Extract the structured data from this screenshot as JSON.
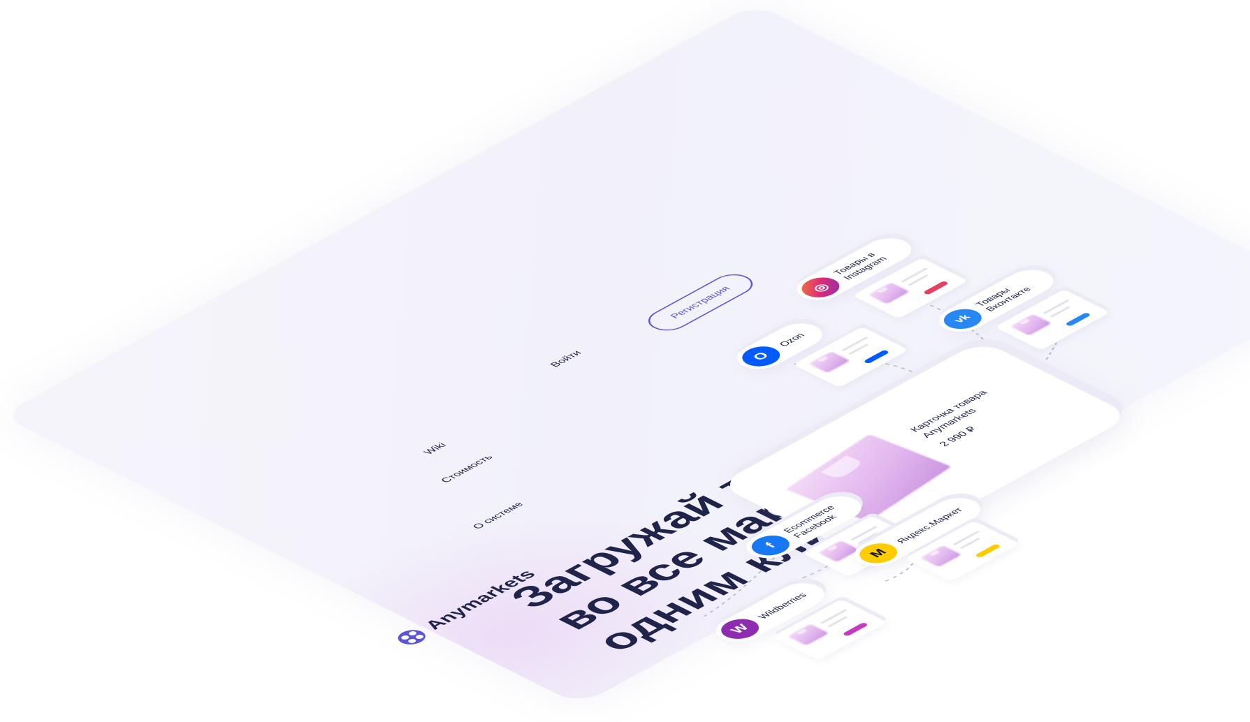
{
  "brand": {
    "name": "Anymarkets"
  },
  "nav": {
    "items": [
      {
        "label": "О системе"
      },
      {
        "label": "Стоимость"
      },
      {
        "label": "Wiki"
      }
    ],
    "login": "Войти",
    "register": "Регистрация"
  },
  "hero": {
    "line1": "Загружай товары",
    "line2": "во все маркетплейсы",
    "line3": "одним кликом"
  },
  "product_card": {
    "title": "Карточка товара Anymarkets",
    "price": "2 990 ₽"
  },
  "marketplaces": [
    {
      "label": "Wildberries",
      "icon": "wildberries-icon",
      "glyph": "W",
      "color": "#8e2bb0",
      "button_color": "#c53ac1"
    },
    {
      "label": "Ecommerce Facebook",
      "icon": "facebook-icon",
      "glyph": "f",
      "color": "#1877f2",
      "button_color": "#1877f2"
    },
    {
      "label": "Яндекс.Маркет",
      "icon": "yandex-market-icon",
      "glyph": "M",
      "color": "#ffcc00",
      "button_color": "#ffcc00"
    },
    {
      "label": "Ozon",
      "icon": "ozon-icon",
      "glyph": "O",
      "color": "#005bff",
      "button_color": "#005bff"
    },
    {
      "label": "Товары в Instagram",
      "icon": "instagram-icon",
      "glyph": "◎",
      "color": "#d6297b",
      "button_color": "#e4405f"
    },
    {
      "label": "Товары Вконтакте",
      "icon": "vk-icon",
      "glyph": "vk",
      "color": "#2787f5",
      "button_color": "#2787f5"
    }
  ],
  "colors": {
    "accent": "#5b55d6",
    "text": "#20234a",
    "background": "#f4f3fa"
  }
}
